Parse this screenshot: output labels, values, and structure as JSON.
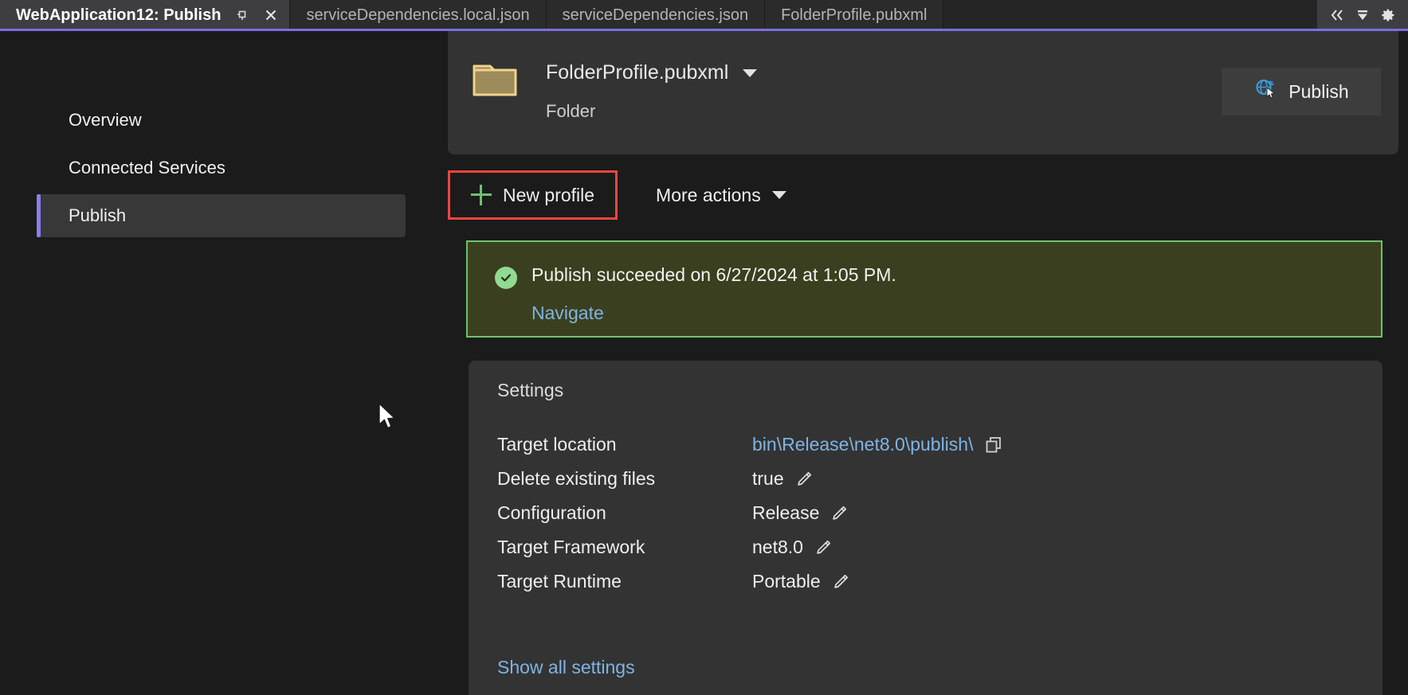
{
  "window": {
    "active_tab": "WebApplication12: Publish",
    "tabs": [
      {
        "label": "WebApplication12: Publish",
        "active": true
      },
      {
        "label": "serviceDependencies.local.json",
        "active": false
      },
      {
        "label": "serviceDependencies.json",
        "active": false
      },
      {
        "label": "FolderProfile.pubxml",
        "active": false
      }
    ],
    "tab_icons": {
      "pin": "pin-icon",
      "close": "close-icon"
    },
    "right_icons": [
      {
        "name": "chevrons-left-icon",
        "glyph": "«"
      },
      {
        "name": "dropdown-list-icon",
        "glyph": "▼"
      },
      {
        "name": "gear-icon",
        "glyph": "⚙"
      }
    ]
  },
  "sidebar": {
    "items": [
      {
        "label": "Overview",
        "selected": false
      },
      {
        "label": "Connected Services",
        "selected": false
      },
      {
        "label": "Publish",
        "selected": true
      }
    ]
  },
  "header": {
    "icon": "folder-icon",
    "profile_name": "FolderProfile.pubxml",
    "profile_type": "Folder",
    "publish_button": "Publish",
    "publish_icon": "globe-publish-icon"
  },
  "toolbar": {
    "new_profile_label": "New profile",
    "new_profile_icon": "plus-icon",
    "more_actions_label": "More actions",
    "more_actions_icon": "chevron-down-icon",
    "highlight_color": "#f2453d"
  },
  "banner": {
    "icon": "check-circle-icon",
    "message": "Publish succeeded on 6/27/2024 at 1:05 PM.",
    "link": "Navigate",
    "border_color": "#6cc36c",
    "background_color": "#3a401f"
  },
  "settings": {
    "title": "Settings",
    "rows": [
      {
        "label": "Target location",
        "value": "bin\\Release\\net8.0\\publish\\",
        "is_link": true,
        "action_icon": "copy-icon"
      },
      {
        "label": "Delete existing files",
        "value": "true",
        "is_link": false,
        "action_icon": "pencil-icon"
      },
      {
        "label": "Configuration",
        "value": "Release",
        "is_link": false,
        "action_icon": "pencil-icon"
      },
      {
        "label": "Target Framework",
        "value": "net8.0",
        "is_link": false,
        "action_icon": "pencil-icon"
      },
      {
        "label": "Target Runtime",
        "value": "Portable",
        "is_link": false,
        "action_icon": "pencil-icon"
      }
    ],
    "show_all_label": "Show all settings"
  },
  "colors": {
    "accent": "#7a6fe0",
    "link": "#7fb4e5",
    "success": "#6cc36c",
    "highlight": "#f2453d",
    "panel": "#333333",
    "background": "#1b1b1c"
  }
}
